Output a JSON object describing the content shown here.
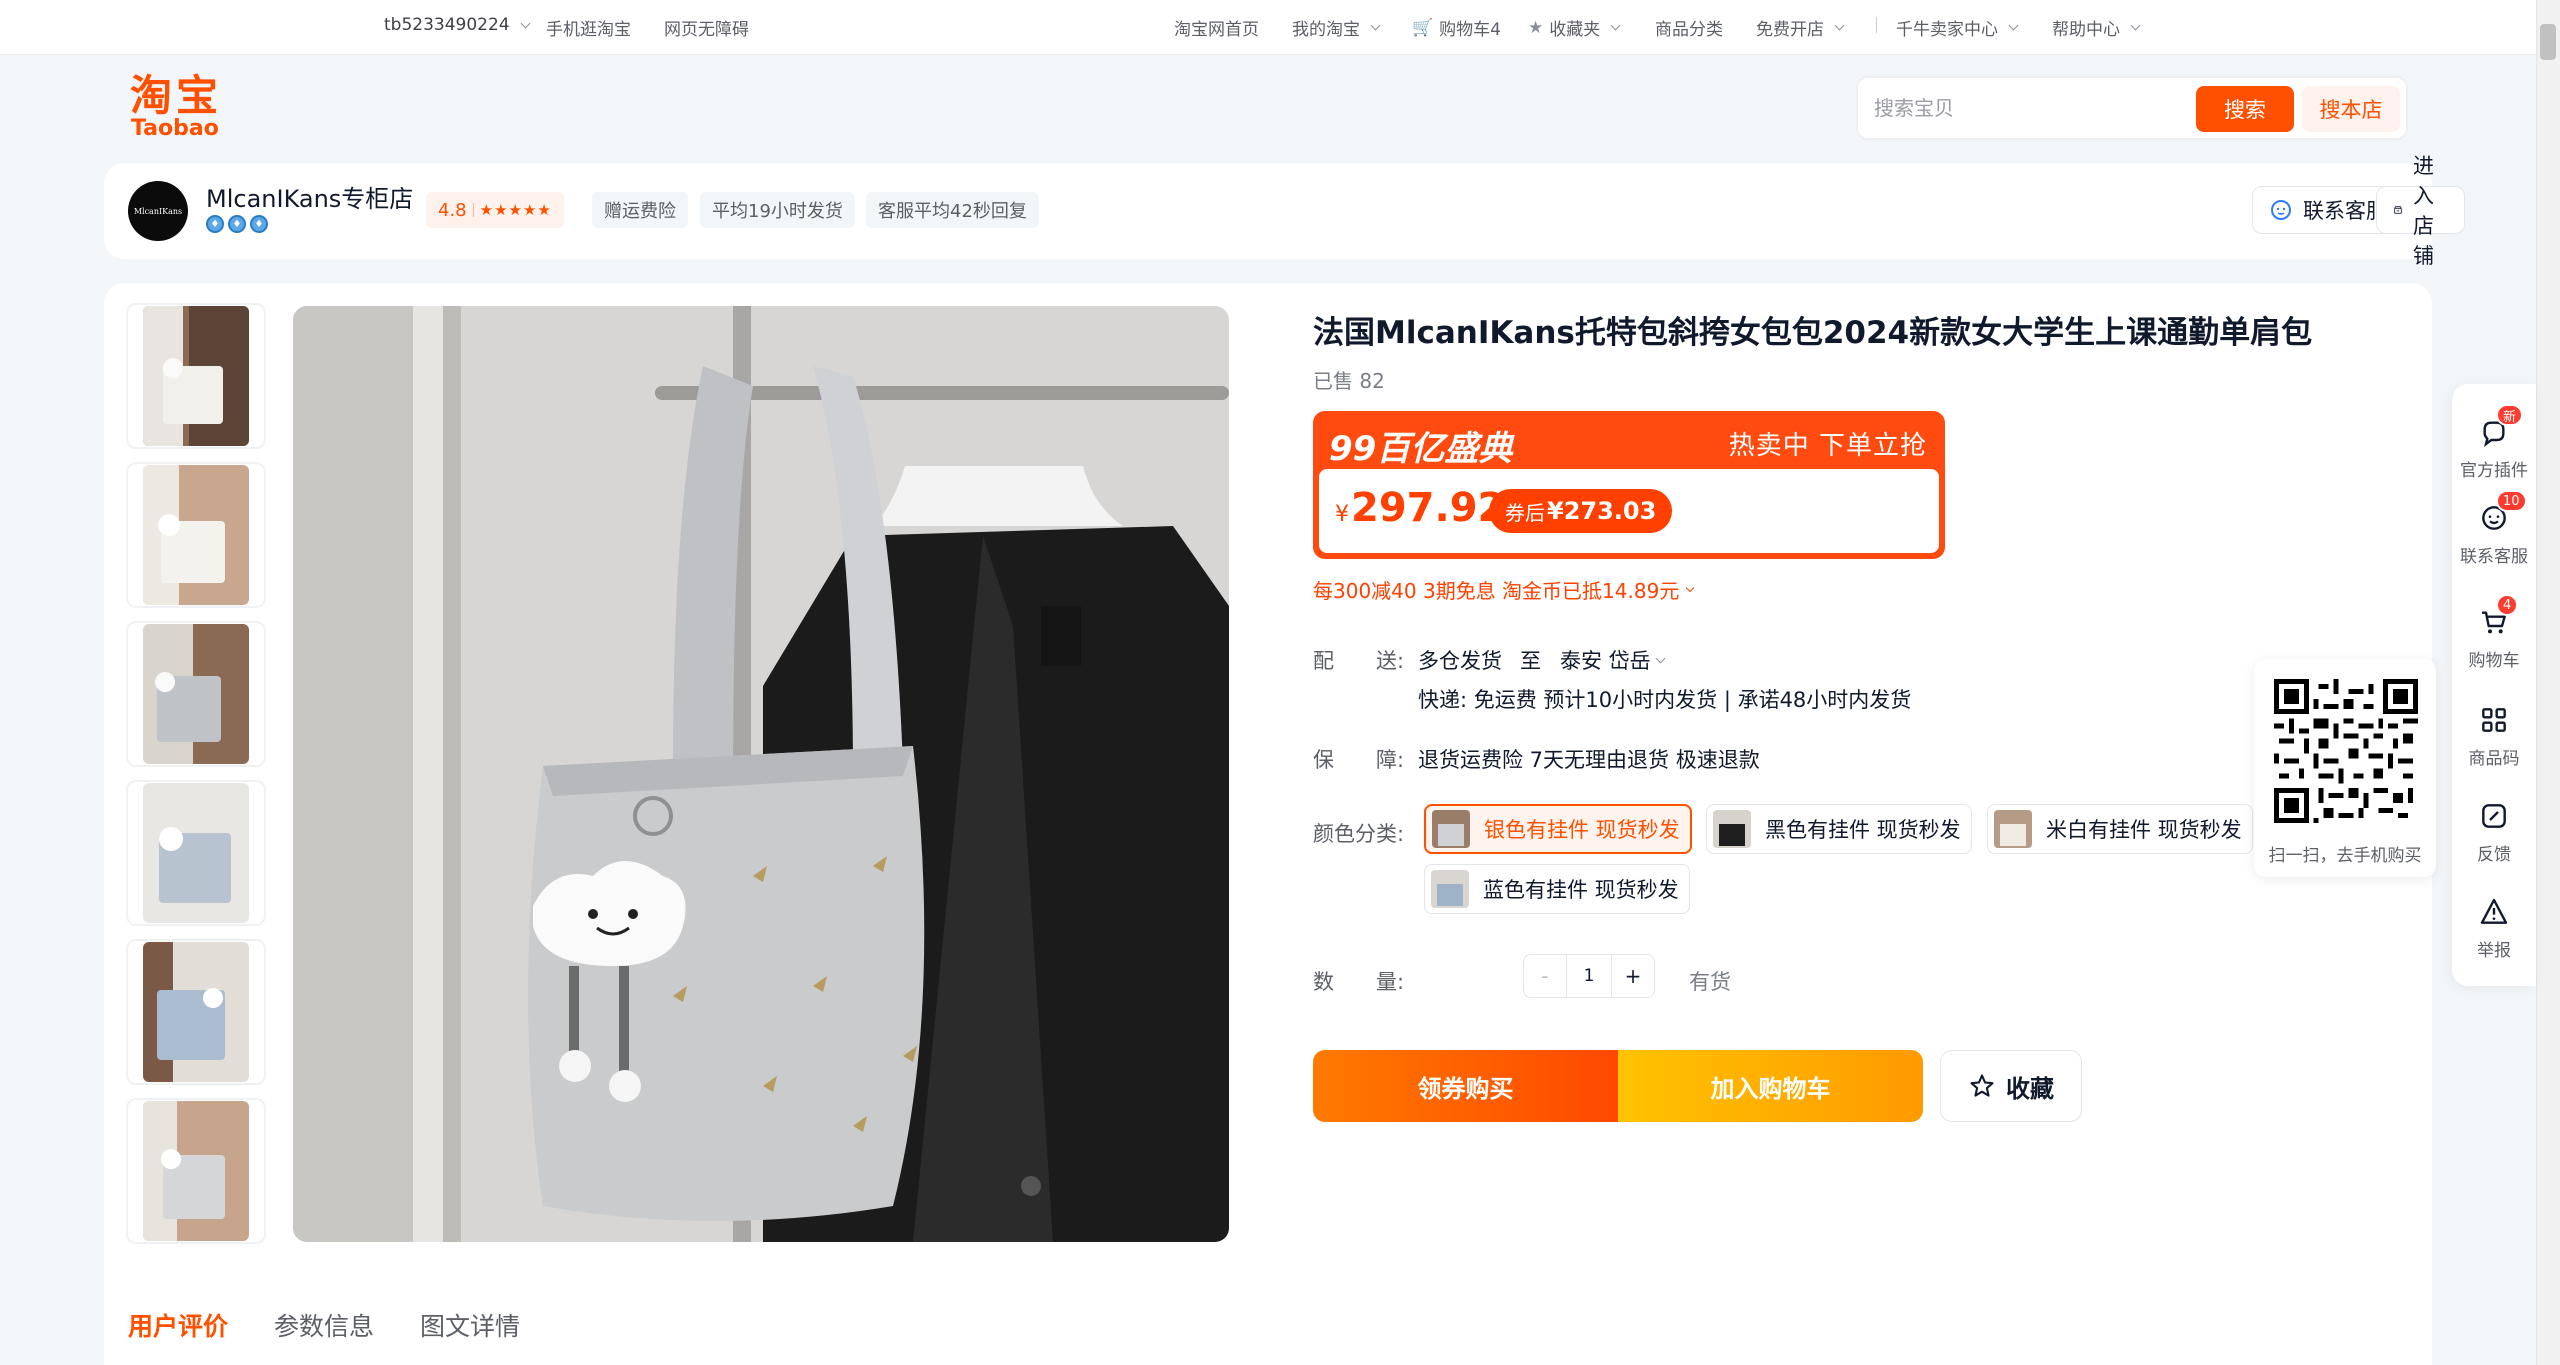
{
  "topnav": {
    "username": "tb5233490224",
    "mobile": "手机逛淘宝",
    "accessible": "网页无障碍",
    "home": "淘宝网首页",
    "my_taobao": "我的淘宝",
    "cart": "购物车4",
    "favorites": "收藏夹",
    "categories": "商品分类",
    "open_shop": "免费开店",
    "seller_center": "千牛卖家中心",
    "help": "帮助中心"
  },
  "logo": {
    "cn": "淘宝",
    "en": "Taobao"
  },
  "search": {
    "placeholder": "搜索宝贝",
    "button": "搜索",
    "shop_button": "搜本店"
  },
  "shop": {
    "avatar_text": "MlcanIKans",
    "name": "MlcanIKans专柜店",
    "rating": "4.8",
    "stars": "★★★★★",
    "chips": [
      "赠运费险",
      "平均19小时发货",
      "客服平均42秒回复"
    ],
    "contact": "联系客服",
    "enter": "进入店铺"
  },
  "product": {
    "title": "法国MlcanIKans托特包斜挎女包包2024新款女大学生上课通勤单肩包",
    "sold": "已售 82",
    "promo_title": "99百亿盛典",
    "promo_slogan": "热卖中 下单立抢",
    "currency": "¥",
    "price": "297.92",
    "coupon_prefix": "券后",
    "coupon_price": "¥273.03",
    "offers": "每300减40 3期免息 淘金币已抵14.89元",
    "delivery_label": "配　　送:",
    "delivery_from": "多仓发货",
    "delivery_to_word": "至",
    "delivery_to": "泰安 岱岳",
    "delivery_detail": "快递: 免运费  预计10小时内发货 | 承诺48小时内发货",
    "guarantee_label": "保　　障:",
    "guarantee": "退货运费险 7天无理由退货 极速退款",
    "color_label": "颜色分类:",
    "skus": [
      "银色有挂件 现货秒发",
      "黑色有挂件 现货秒发",
      "米白有挂件 现货秒发",
      "蓝色有挂件 现货秒发"
    ],
    "qty_label": "数　　量:",
    "qty_minus": "-",
    "qty_value": "1",
    "qty_plus": "+",
    "stock": "有货",
    "buy_coupon": "领券购买",
    "add_cart": "加入购物车",
    "favorite": "收藏"
  },
  "tabs": [
    "用户评价",
    "参数信息",
    "图文详情"
  ],
  "qr_caption": "扫一扫，去手机购买",
  "sidebar": [
    {
      "label": "官方插件",
      "badge": "新"
    },
    {
      "label": "联系客服",
      "badge": "10"
    },
    {
      "label": "购物车",
      "badge": "4"
    },
    {
      "label": "商品码",
      "badge": ""
    },
    {
      "label": "反馈",
      "badge": ""
    },
    {
      "label": "举报",
      "badge": ""
    }
  ],
  "colors": {
    "brand": "#ff5000",
    "price": "#ff4000",
    "page_bg": "#f3f6f8"
  }
}
